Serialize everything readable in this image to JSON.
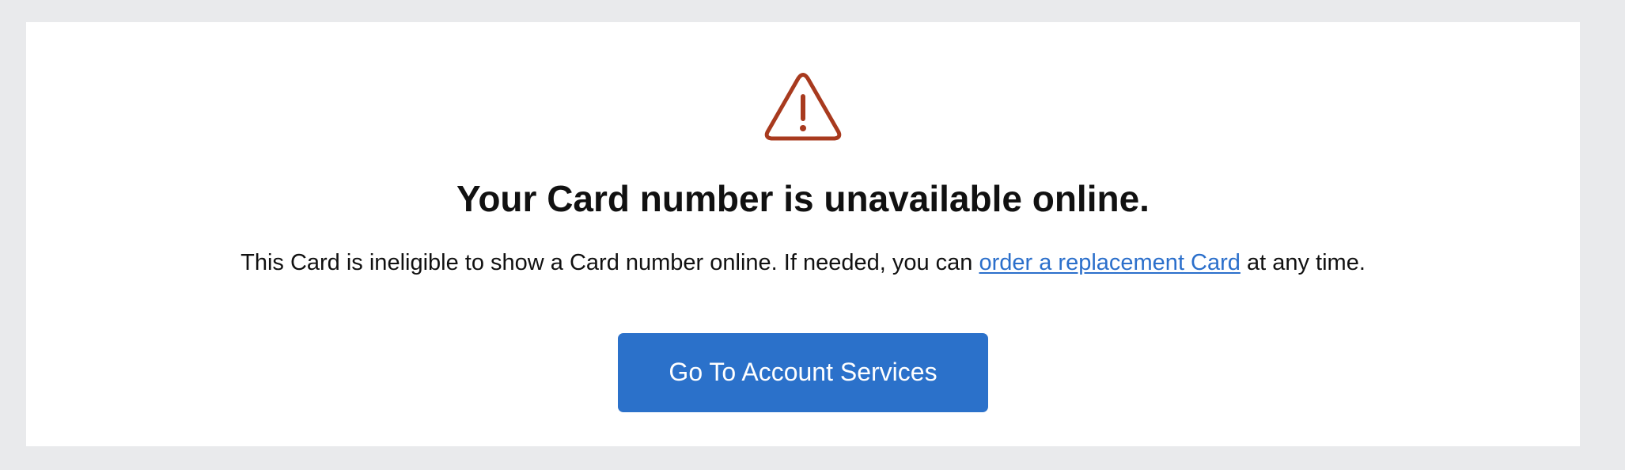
{
  "colors": {
    "page_background": "#e9eaec",
    "card_background": "#ffffff",
    "warning_icon": "#a83a1e",
    "link": "#2b6fcb",
    "primary_button": "#2b71ca",
    "text": "#111111"
  },
  "icon": {
    "name": "warning-triangle-icon"
  },
  "heading": "Your Card number is unavailable online.",
  "message": {
    "before_link": "This Card is ineligible to show a Card number online. If needed, you can ",
    "link_text": "order a replacement Card",
    "after_link": " at any time."
  },
  "button": {
    "label": "Go To Account Services"
  }
}
